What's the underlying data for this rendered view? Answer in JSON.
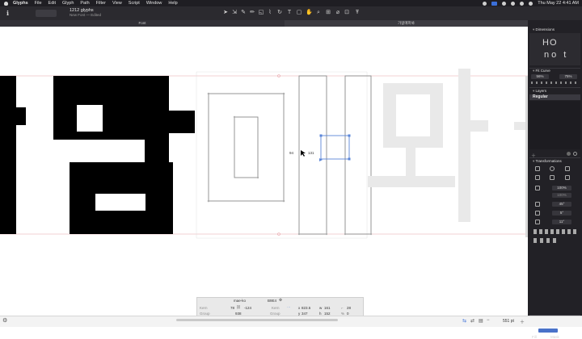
{
  "menubar": {
    "items": [
      "Glyphs",
      "File",
      "Edit",
      "Glyph",
      "Path",
      "Filter",
      "View",
      "Script",
      "Window",
      "Help"
    ],
    "clock": "Thu May 22  4:41 AM"
  },
  "document": {
    "title": "1212 glyphs",
    "subtitle": "New Font — Edited"
  },
  "tabs": [
    {
      "label": "Font"
    },
    {
      "label": "가없매파봐"
    }
  ],
  "canvas": {
    "glyphs": [
      "나",
      "망",
      "매",
      "와"
    ],
    "measure_left": "94",
    "measure_right": "131"
  },
  "sidebar": {
    "dimensions": {
      "title": "Dimensions",
      "preview": [
        "HO",
        "no t"
      ]
    },
    "fit_curve": {
      "title": "Fit Curve",
      "values": [
        "56%",
        "75%"
      ]
    },
    "layers": {
      "title": "Layers",
      "active": "Regular"
    },
    "transformations": {
      "title": "Transformations",
      "scale": "100%",
      "scale2": "100%",
      "rotate": "45°",
      "slant": "5°",
      "skew": "11°"
    },
    "stroke": {
      "title": "Stroke",
      "w_label": "W",
      "h_label": "H",
      "fill_label": "Fill",
      "mask_label": "Mask"
    }
  },
  "info": {
    "glyph_name": "mae-ko",
    "unicode": "B9E4",
    "kern_label": "Kern",
    "kern_left": "78",
    "kern_right": "-124",
    "group_label": "Group",
    "width": "938",
    "x": "823.5",
    "y": "347",
    "w": "161",
    "h": "152",
    "angle": "28",
    "zero": "0"
  },
  "status": {
    "zoom": "551 pt"
  },
  "colors": {
    "menubar": "#1f1e23",
    "toolbar": "#2b2a2f",
    "sidebar": "#222126",
    "accent": "#3b6fd8",
    "guide": "#e8a3a8"
  }
}
